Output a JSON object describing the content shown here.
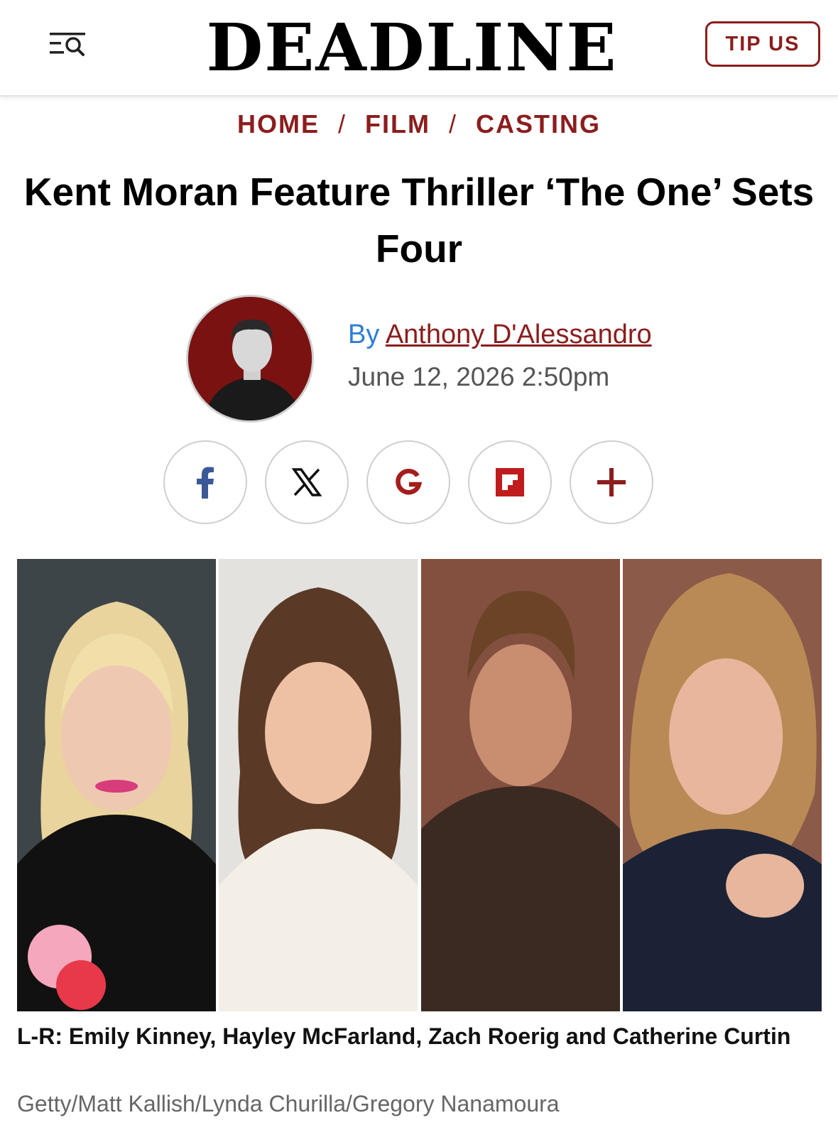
{
  "header": {
    "logo": "DEADLINE",
    "tip_label": "TIP US",
    "menu_icon": "menu-search-icon"
  },
  "breadcrumb": {
    "items": [
      "HOME",
      "FILM",
      "CASTING"
    ],
    "separator": "/"
  },
  "article": {
    "title": "Kent Moran Feature Thriller ‘The One’ Sets Four",
    "by_prefix": "By",
    "author": "Anthony D'Alessandro",
    "date": "June 12, 2026 2:50pm"
  },
  "share": {
    "buttons": [
      "facebook-icon",
      "x-icon",
      "google-icon",
      "flipboard-icon",
      "plus-icon"
    ],
    "colors": {
      "facebook": "#3b5998",
      "accent": "#8c1d1d"
    }
  },
  "photo": {
    "caption": "L-R: Emily Kinney, Hayley McFarland, Zach Roerig and Catherine Curtin",
    "credit": "Getty/Matt Kallish/Lynda Churilla/Gregory Nanamoura"
  },
  "colors": {
    "brand_red": "#8c1d1d",
    "link_blue": "#2e7dd7"
  }
}
